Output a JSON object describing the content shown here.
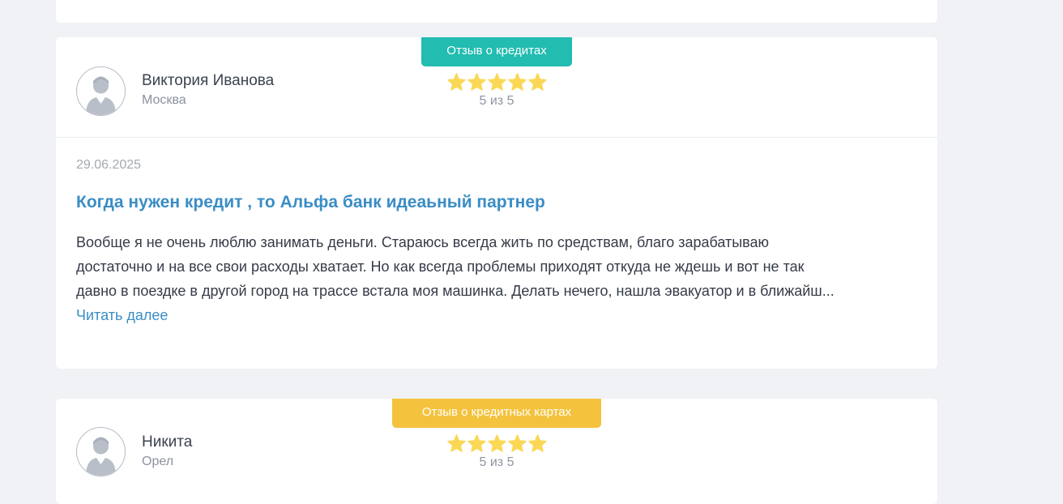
{
  "colors": {
    "page_background": "#f0f2f5",
    "card_background": "#ffffff",
    "badge_credits": "#22bcb0",
    "badge_cards": "#f4c23d",
    "star": "#fad855",
    "link": "#3a8dc5"
  },
  "reviews": [
    {
      "badge": "Отзыв о кредитах",
      "author_name": "Виктория Иванова",
      "author_city": "Москва",
      "avatar_icon": "user-silhouette-icon",
      "stars": 5,
      "rating_text": "5 из 5",
      "date": "29.06.2025",
      "title": "Когда нужен кредит , то Альфа банк идеаьный партнер",
      "text_lines": [
        "Вообще я не очень люблю занимать деньги. Стараюсь всегда жить по средствам, благо зарабатываю",
        "достаточно и на все свои расходы хватает. Но как всегда проблемы приходят откуда не ждешь и вот не так",
        "давно в поездке в другой город на трассе встала моя машинка. Делать нечего, нашла эвакуатор и в ближайш..."
      ],
      "read_more": "Читать далее"
    },
    {
      "badge": "Отзыв о кредитных картах",
      "author_name": "Никита",
      "author_city": "Орел",
      "avatar_icon": "user-silhouette-icon",
      "stars": 5,
      "rating_text": "5 из 5"
    }
  ]
}
